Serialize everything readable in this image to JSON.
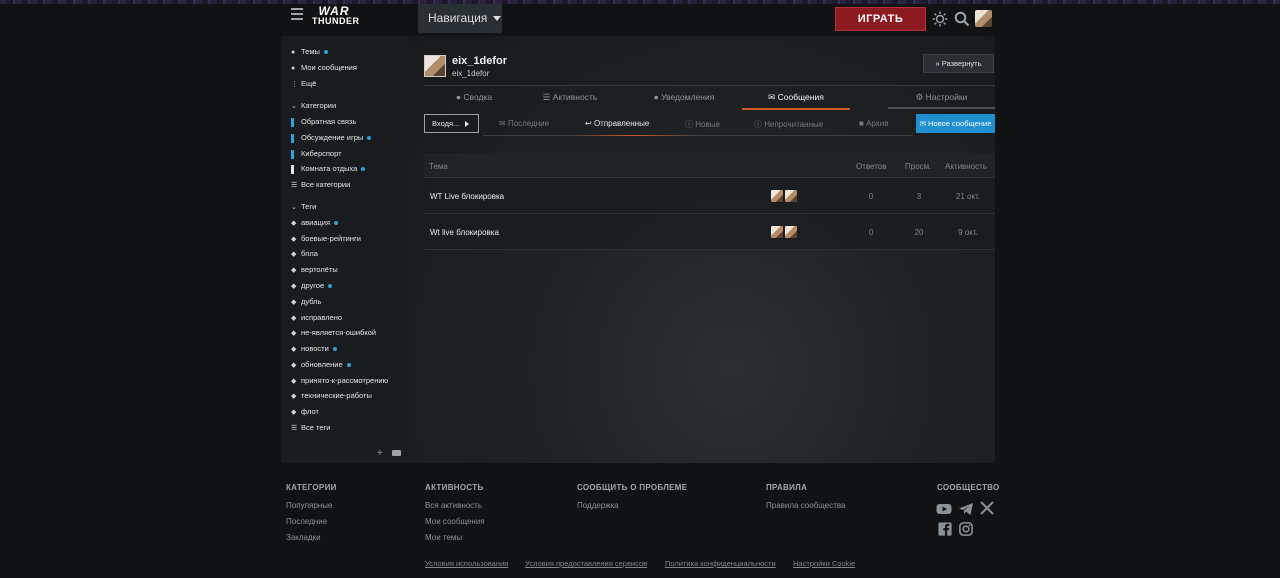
{
  "header": {
    "logo_line1": "WAR",
    "logo_line2": "THUNDER",
    "nav_label": "Навигация",
    "play_label": "ИГРАТЬ"
  },
  "sidebar": {
    "top_items": [
      {
        "label": "Темы",
        "dot": true
      },
      {
        "label": "Мои сообщения",
        "dot": false
      },
      {
        "label": "Ещё",
        "dot": false
      }
    ],
    "categories_header": "Категории",
    "categories": [
      {
        "label": "Обратная связь",
        "color": "#2f9fd8",
        "dot": false
      },
      {
        "label": "Обсуждение игры",
        "color": "#2f9fd8",
        "dot": true
      },
      {
        "label": "Киберспорт",
        "color": "#2f9fd8",
        "dot": false
      },
      {
        "label": "Комната отдыха",
        "color": "#e2e6e8",
        "dot": true
      },
      {
        "label": "Все категории",
        "color": "",
        "dot": false
      }
    ],
    "tags_header": "Теги",
    "tags": [
      {
        "label": "авиация",
        "dot": true
      },
      {
        "label": "боевые-рейтинги",
        "dot": false
      },
      {
        "label": "бпла",
        "dot": false
      },
      {
        "label": "вертолёты",
        "dot": false
      },
      {
        "label": "другое",
        "dot": true
      },
      {
        "label": "дубль",
        "dot": false
      },
      {
        "label": "исправлено",
        "dot": false
      },
      {
        "label": "не-является-ошибкой",
        "dot": false
      },
      {
        "label": "новости",
        "dot": true
      },
      {
        "label": "обновление",
        "dot": true
      },
      {
        "label": "принято-к-рассмотрению",
        "dot": false
      },
      {
        "label": "технические-работы",
        "dot": false
      },
      {
        "label": "флот",
        "dot": false
      },
      {
        "label": "Все теги",
        "dot": false
      }
    ]
  },
  "profile": {
    "username": "eix_1defor",
    "display_name": "eix_1defor",
    "expand_label": "Развернуть"
  },
  "tabs": [
    {
      "label": "Сводка",
      "active": false
    },
    {
      "label": "Активность",
      "active": false
    },
    {
      "label": "Уведомления",
      "active": false
    },
    {
      "label": "Сообщения",
      "active": true
    },
    {
      "label": "Настройки",
      "active": false
    }
  ],
  "subtabs": {
    "inbox_label": "Входя...",
    "items": [
      {
        "label": "Последние",
        "active": false
      },
      {
        "label": "Отправленные",
        "active": true
      },
      {
        "label": "Новые",
        "active": false
      },
      {
        "label": "Непрочитанные",
        "active": false
      },
      {
        "label": "Архив",
        "active": false
      }
    ],
    "new_message_label": "Новое сообщение"
  },
  "table": {
    "headers": {
      "topic": "Тема",
      "replies": "Ответов",
      "views": "Просм.",
      "activity": "Активность"
    },
    "rows": [
      {
        "topic": "WT Live блокировка",
        "replies": "0",
        "views": "3",
        "activity": "21 окт."
      },
      {
        "topic": "Wt live блокировка",
        "replies": "0",
        "views": "20",
        "activity": "9 окт."
      }
    ]
  },
  "footer": {
    "columns": [
      {
        "title": "КАТЕГОРИИ",
        "links": [
          "Популярные",
          "Последние",
          "Закладки"
        ]
      },
      {
        "title": "АКТИВНОСТЬ",
        "links": [
          "Вся активность",
          "Мои сообщения",
          "Мои темы"
        ]
      },
      {
        "title": "СООБЩИТЬ О ПРОБЛЕМЕ",
        "links": [
          "Поддержка"
        ]
      },
      {
        "title": "ПРАВИЛА",
        "links": [
          "Правила сообщества"
        ]
      },
      {
        "title": "СООБЩЕСТВО",
        "links": []
      }
    ],
    "bottom_links": [
      "Условия использования",
      "Условия предоставления сервисов",
      "Политика конфиденциальности",
      "Настройки Cookie"
    ],
    "social_icons": [
      "youtube-icon",
      "telegram-icon",
      "x-icon",
      "facebook-icon",
      "instagram-icon"
    ]
  },
  "colors": {
    "accent": "#d0582a",
    "play": "#8c1b1f",
    "primary_button": "#1f8fcf",
    "dot": "#2f9fd8"
  }
}
